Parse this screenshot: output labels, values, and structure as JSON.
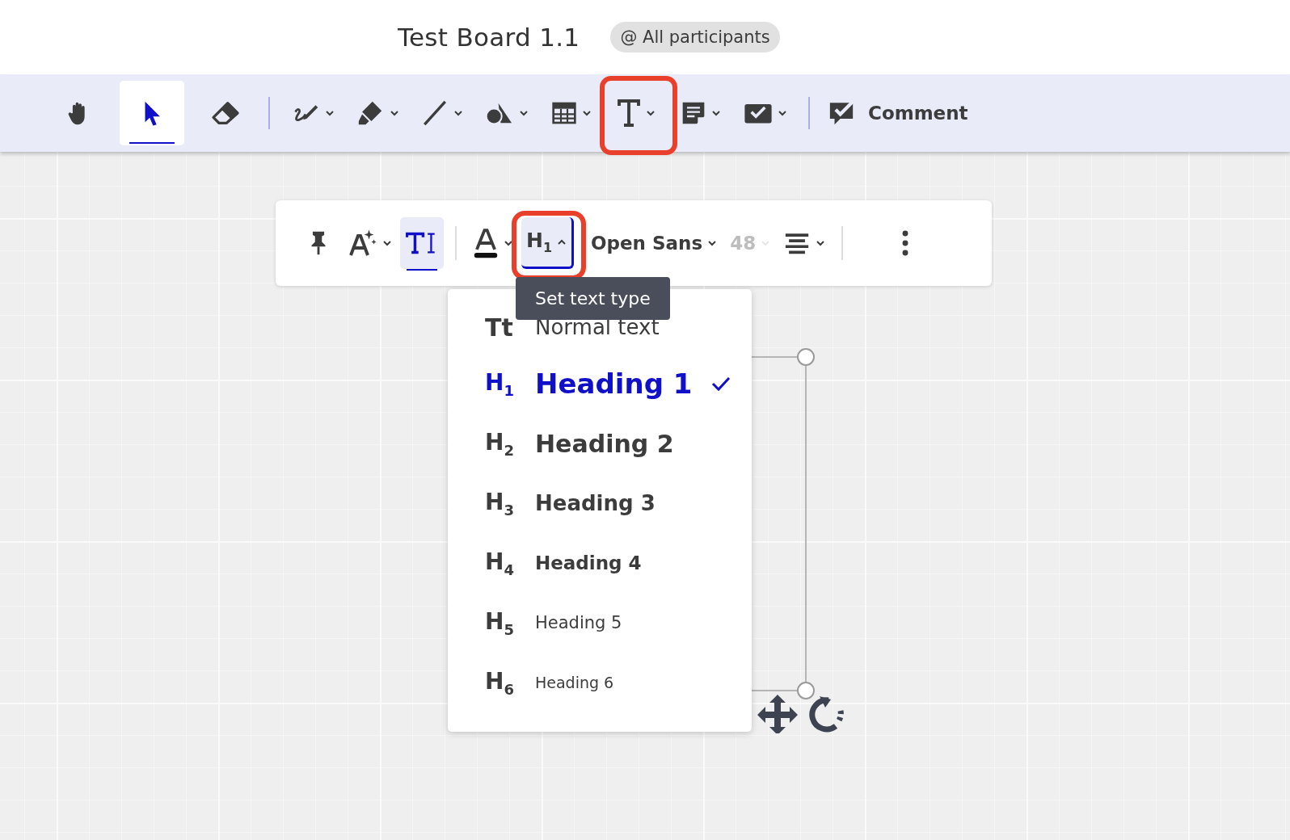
{
  "board": {
    "title": "Test Board 1.1",
    "audience": "@ All participants"
  },
  "toolbar": {
    "groups": [
      [
        {
          "kind": "hand",
          "selected": false,
          "has_menu": false,
          "annotated": false
        },
        {
          "kind": "select",
          "selected": true,
          "has_menu": false,
          "annotated": false
        },
        {
          "kind": "eraser",
          "selected": false,
          "has_menu": false,
          "annotated": false
        }
      ],
      [
        {
          "kind": "pen",
          "selected": false,
          "has_menu": true,
          "annotated": false
        },
        {
          "kind": "highlighter",
          "selected": false,
          "has_menu": true,
          "annotated": false
        },
        {
          "kind": "line",
          "selected": false,
          "has_menu": true,
          "annotated": false
        },
        {
          "kind": "shapes",
          "selected": false,
          "has_menu": true,
          "annotated": false
        },
        {
          "kind": "table",
          "selected": false,
          "has_menu": true,
          "annotated": false
        },
        {
          "kind": "text",
          "selected": false,
          "has_menu": true,
          "annotated": true
        },
        {
          "kind": "note",
          "selected": false,
          "has_menu": true,
          "annotated": false
        },
        {
          "kind": "checkbox",
          "selected": false,
          "has_menu": true,
          "annotated": false
        }
      ],
      [
        {
          "kind": "comment",
          "label": "Comment",
          "selected": false,
          "has_menu": false,
          "annotated": false
        }
      ]
    ]
  },
  "text_toolbar": {
    "groups": [
      [
        {
          "kind": "pin",
          "selected": false,
          "has_menu": false,
          "annotated": false,
          "disabled": false
        },
        {
          "kind": "ai-text",
          "selected": false,
          "has_menu": true,
          "annotated": false,
          "disabled": false
        },
        {
          "kind": "text-mode",
          "selected": true,
          "has_menu": false,
          "annotated": false,
          "disabled": false
        }
      ],
      [
        {
          "kind": "color",
          "selected": false,
          "has_menu": true,
          "annotated": false,
          "disabled": false
        },
        {
          "kind": "text-type",
          "label": "H$_{1}$",
          "selected": true,
          "has_menu": true,
          "open": true,
          "annotated": true,
          "disabled": false
        },
        {
          "kind": "font",
          "label": "Open Sans",
          "selected": false,
          "has_menu": true,
          "annotated": false,
          "disabled": false
        },
        {
          "kind": "size",
          "label": "48",
          "selected": false,
          "has_menu": true,
          "annotated": false,
          "disabled": true
        },
        {
          "kind": "align",
          "selected": false,
          "has_menu": true,
          "annotated": false,
          "disabled": false
        }
      ],
      [
        {
          "kind": "more",
          "selected": false,
          "has_menu": false,
          "annotated": false,
          "disabled": false
        }
      ]
    ]
  },
  "tooltip": "Set text type",
  "text_type_menu": [
    {
      "kind": "normal",
      "marker": "Tt",
      "label": "Normal text",
      "selected": false
    },
    {
      "kind": "h1",
      "marker": "H$_{1}$",
      "label": "Heading 1",
      "selected": true
    },
    {
      "kind": "h2",
      "marker": "H$_{2}$",
      "label": "Heading 2",
      "selected": false
    },
    {
      "kind": "h3",
      "marker": "H$_{3}$",
      "label": "Heading 3",
      "selected": false
    },
    {
      "kind": "h4",
      "marker": "H$_{4}$",
      "label": "Heading 4",
      "selected": false
    },
    {
      "kind": "h5",
      "marker": "H$_{5}$",
      "label": "Heading 5",
      "selected": false
    },
    {
      "kind": "h6",
      "marker": "H$_{6}$",
      "label": "Heading 6",
      "selected": false
    }
  ]
}
